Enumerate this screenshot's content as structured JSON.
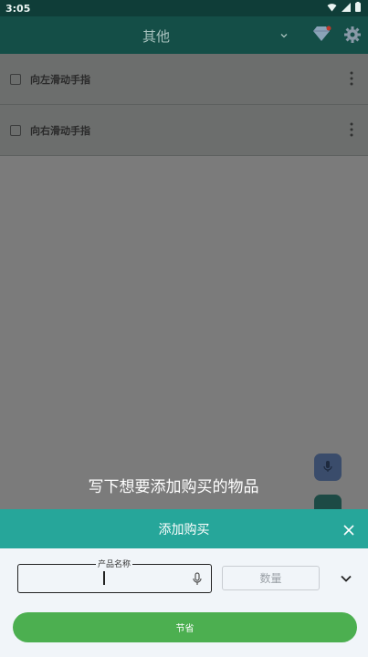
{
  "status_bar": {
    "time": "3:05"
  },
  "app_bar": {
    "title": "其他"
  },
  "list": {
    "items": [
      {
        "label": "向左滑动手指"
      },
      {
        "label": "向右滑动手指"
      }
    ]
  },
  "hint": {
    "text": "写下想要添加购买的物品"
  },
  "sheet": {
    "title": "添加购买",
    "name_label": "产品名称",
    "name_value": "",
    "quantity_placeholder": "数量",
    "save_label": "节省"
  },
  "colors": {
    "accent": "#26a69a",
    "app_bar": "#144e47",
    "save_button": "#4caf50"
  }
}
